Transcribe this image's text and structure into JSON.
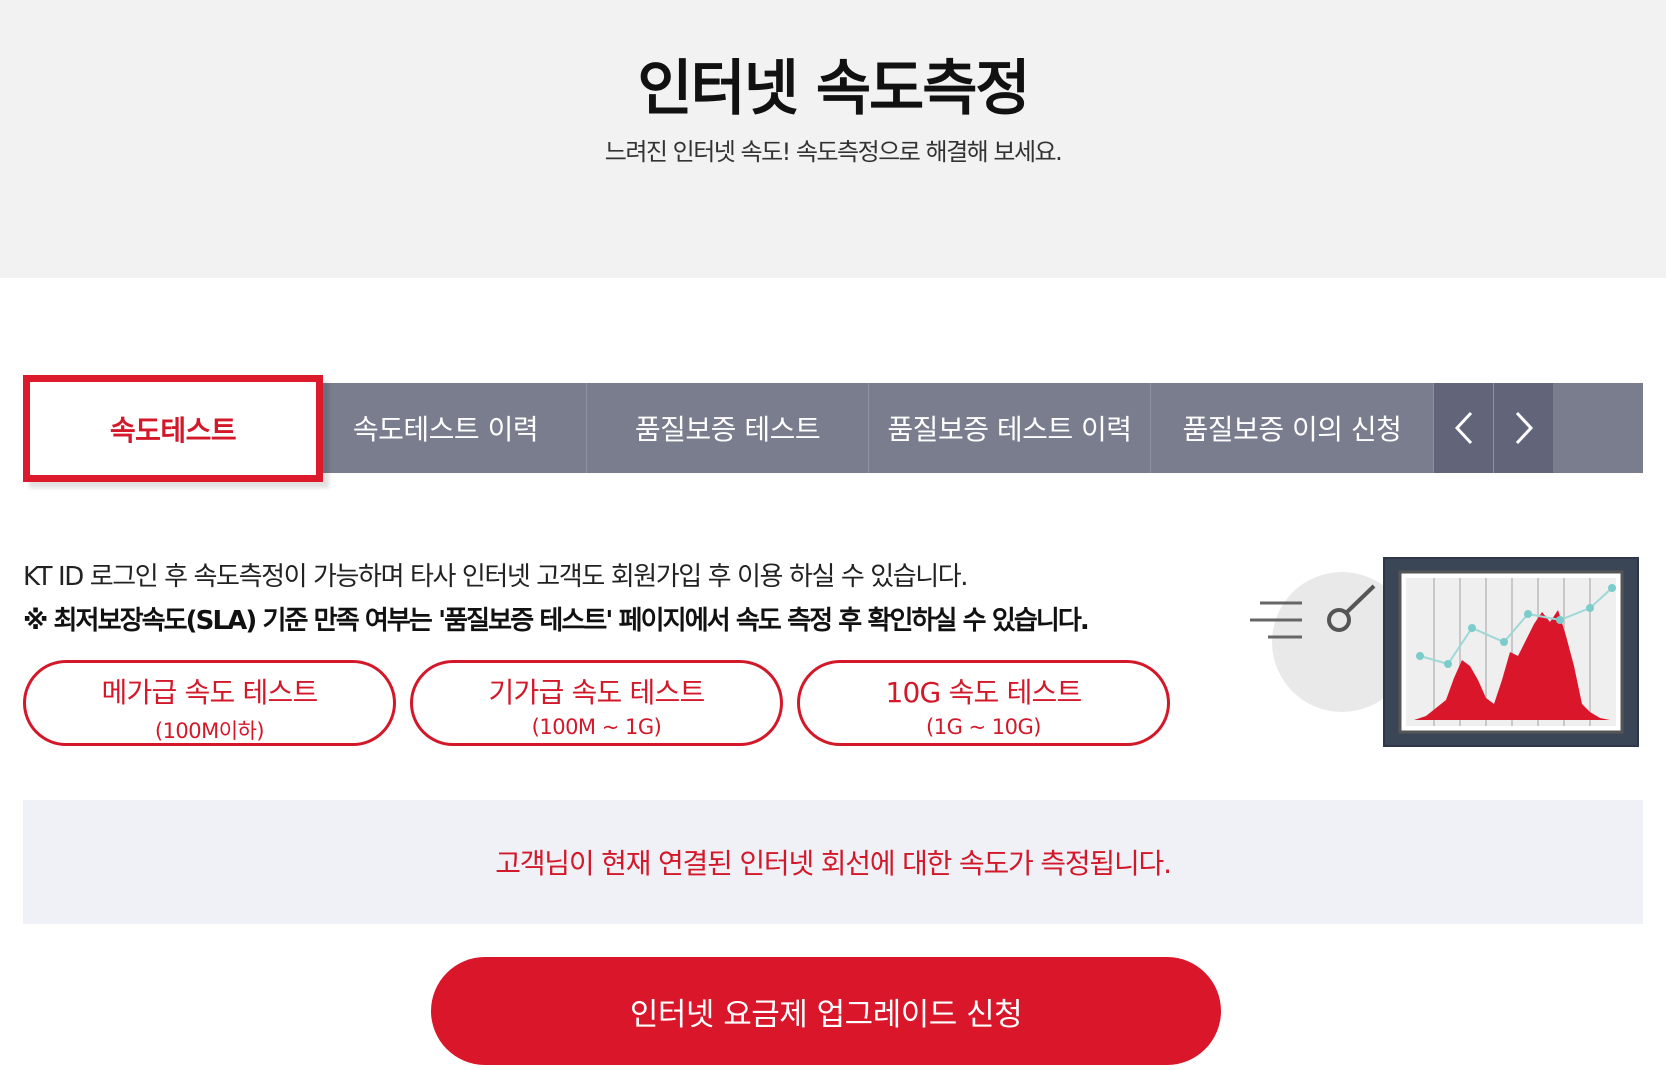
{
  "hero": {
    "title": "인터넷 속도측정",
    "subtitle": "느려진 인터넷 속도! 속도측정으로 해결해 보세요."
  },
  "tabs": [
    {
      "label": "속도테스트",
      "active": true
    },
    {
      "label": "속도테스트 이력",
      "active": false
    },
    {
      "label": "품질보증 테스트",
      "active": false
    },
    {
      "label": "품질보증 테스트 이력",
      "active": false
    },
    {
      "label": "품질보증 이의 신청",
      "active": false
    }
  ],
  "tab_arrows": {
    "prev_icon": "chevron-left-icon",
    "next_icon": "chevron-right-icon"
  },
  "info": {
    "line1": "KT ID 로그인 후 속도측정이 가능하며 타사 인터넷 고객도 회원가입 후 이용 하실 수 있습니다.",
    "line2": "※ 최저보장속도(SLA) 기준 만족 여부는 '품질보증 테스트' 페이지에서 속도 측정 후 확인하실 수 있습니다."
  },
  "speed_tests": [
    {
      "label": "메가급 속도 테스트",
      "range": "(100M이하)"
    },
    {
      "label": "기가급 속도 테스트",
      "range": "(100M ~ 1G)"
    },
    {
      "label": "10G 속도 테스트",
      "range": "(1G ~ 10G)"
    }
  ],
  "notice": "고객님이 현재 연결된 인터넷 회선에 대한 속도가 측정됩니다.",
  "upgrade_button": "인터넷 요금제 업그레이드 신청",
  "colors": {
    "accent": "#d9162a",
    "tab_bg": "#7a7d8e",
    "hero_bg": "#f2f2f2",
    "notice_bg": "#eff1f7"
  }
}
